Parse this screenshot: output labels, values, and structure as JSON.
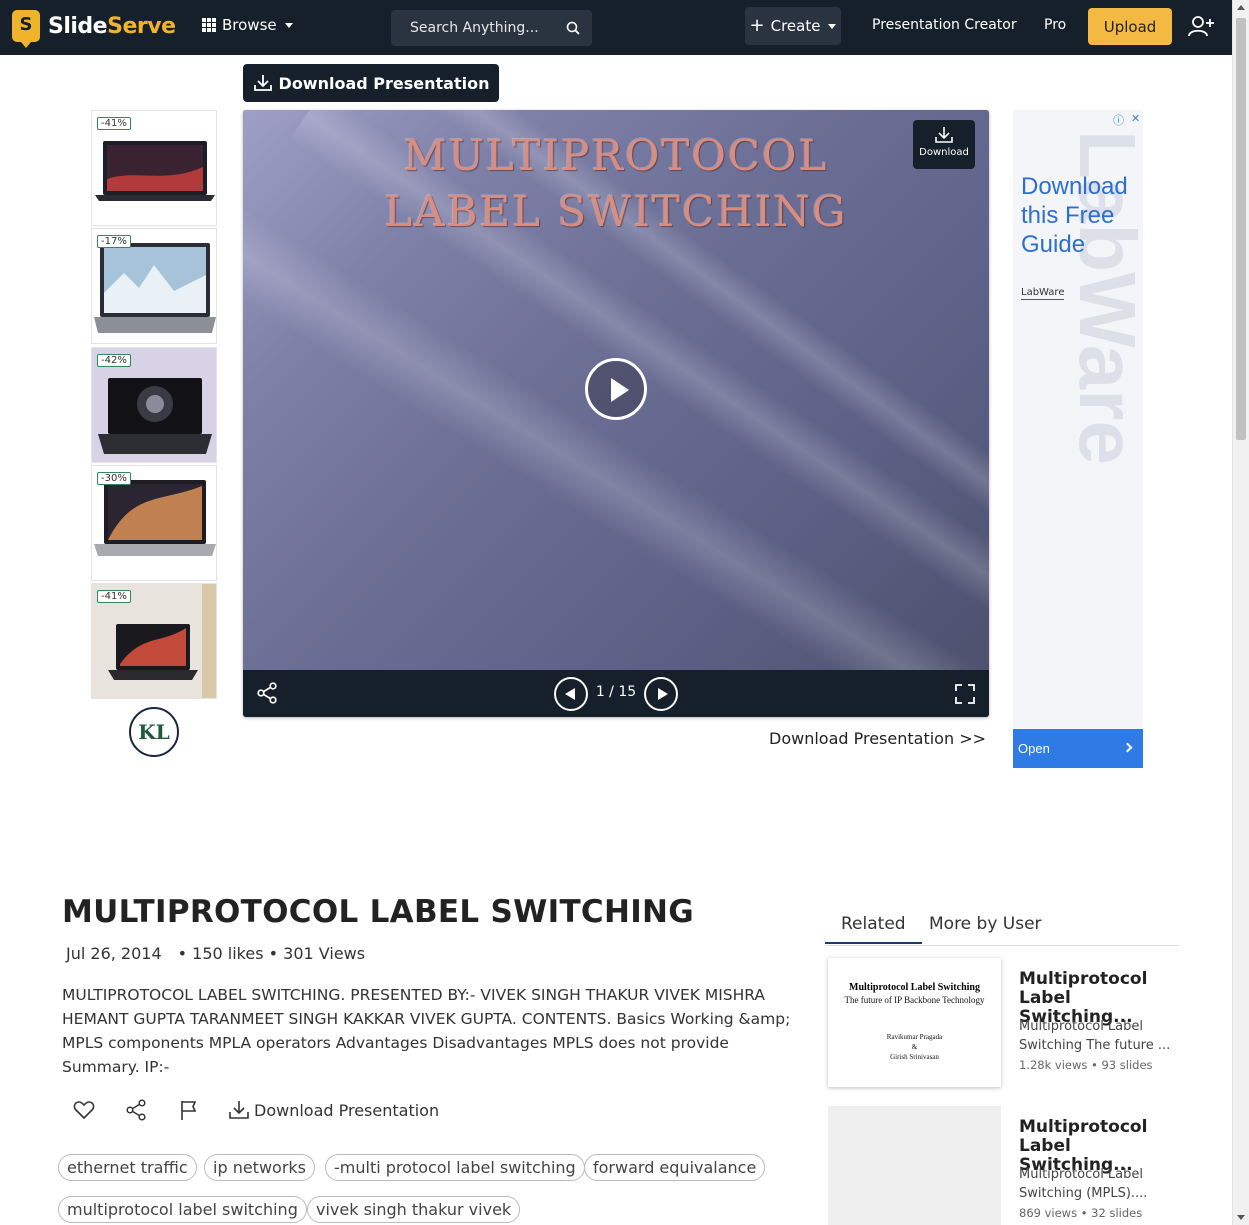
{
  "header": {
    "logo_prefix": "Slide",
    "logo_suffix": "Serve",
    "logo_letter": "S",
    "browse_label": "Browse",
    "search_placeholder": "Search Anything...",
    "create_label": "Create",
    "presentation_creator": "Presentation Creator",
    "pro": "Pro",
    "upload": "Upload"
  },
  "top_download": "Download Presentation",
  "left_ad": {
    "badges": [
      "-41%",
      "-17%",
      "-42%",
      "-30%",
      "-41%"
    ],
    "brand_mark": "KL"
  },
  "player": {
    "slide_title": "MULTIPROTOCOL LABEL SWITCHING",
    "download_label": "Download",
    "page_current": 1,
    "page_total": 15,
    "page_label": "1 / 15"
  },
  "download_link": "Download Presentation >>",
  "right_ad": {
    "headline": "Download this Free Guide",
    "brand": "LabWare",
    "watermark": "LabWare",
    "open_label": "Open"
  },
  "presentation": {
    "title": "MULTIPROTOCOL LABEL SWITCHING",
    "date": "Jul 26, 2014",
    "stats": "• 150 likes • 301 Views",
    "description": "MULTIPROTOCOL LABEL SWITCHING. PRESENTED BY:- VIVEK SINGH THAKUR VIVEK MISHRA HEMANT GUPTA TARANMEET SINGH KAKKAR VIVEK GUPTA. CONTENTS. Basics Working &amp; MPLS components MPLA operators Advantages Disadvantages MPLS does not provide Summary. IP:-",
    "download_action": "Download Presentation",
    "tags": [
      "ethernet traffic",
      "ip networks",
      "-multi protocol label switching",
      "forward equivalance",
      "multiprotocol label switching",
      "vivek singh thakur vivek"
    ]
  },
  "sidebar": {
    "tabs": [
      "Related",
      "More by User"
    ],
    "related": [
      {
        "thumb_title": "Multiprotocol Label Switching",
        "thumb_subtitle": "The future of IP Backbone Technology",
        "thumb_authors": [
          "Ravikumar Pragada",
          "&",
          "Girish Srinivasan"
        ],
        "title": "Multiprotocol Label Switching...",
        "desc": "Multiprotocol Label Switching The future ...",
        "stats": "1.28k views • 93 slides"
      },
      {
        "title": "Multiprotocol Label Switching...",
        "desc": "Multiprotocol Label Switching (MPLS)....",
        "stats": "869 views • 32 slides"
      }
    ]
  },
  "colors": {
    "header_bg": "#16202b",
    "accent": "#f0b42c",
    "upload_bg": "#f4b942",
    "ad_blue": "#2f7be6"
  }
}
